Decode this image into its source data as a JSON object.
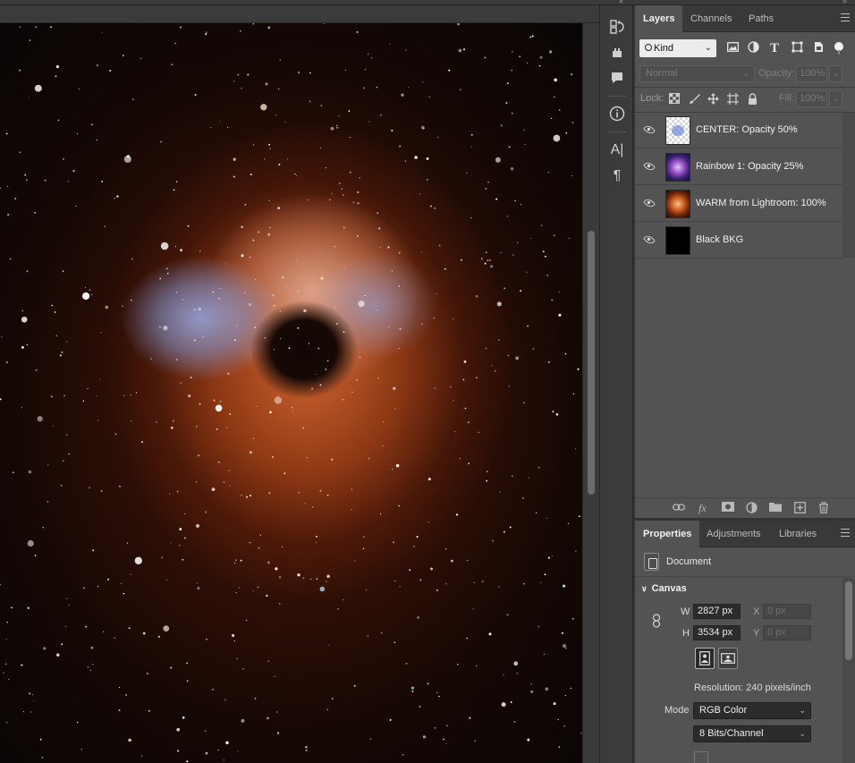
{
  "layers_panel": {
    "tabs": [
      {
        "label": "Layers",
        "active": true
      },
      {
        "label": "Channels",
        "active": false
      },
      {
        "label": "Paths",
        "active": false
      }
    ],
    "filter_kind": "Kind",
    "filter_icons": [
      "image-filter-icon",
      "adjustment-filter-icon",
      "type-filter-icon",
      "shape-filter-icon",
      "smart-object-filter-icon",
      "filter-toggle-icon"
    ],
    "blend_mode": "Normal",
    "opacity_label": "Opacity:",
    "opacity_value": "100%",
    "lock_label": "Lock:",
    "fill_label": "Fill:",
    "fill_value": "100%",
    "layers": [
      {
        "name": "CENTER: Opacity 50%",
        "visible": true,
        "thumb": "transparent-blue"
      },
      {
        "name": "Rainbow 1: Opacity 25%",
        "visible": true,
        "thumb": "purple-nebula"
      },
      {
        "name": "WARM from Lightroom: 100%",
        "visible": true,
        "thumb": "orange-nebula"
      },
      {
        "name": "Black BKG",
        "visible": true,
        "thumb": "black"
      }
    ],
    "footer_icons": [
      "link-icon",
      "fx-icon",
      "mask-icon",
      "adjustment-icon",
      "folder-icon",
      "new-layer-icon",
      "trash-icon"
    ]
  },
  "properties_panel": {
    "tabs": [
      {
        "label": "Properties",
        "active": true
      },
      {
        "label": "Adjustments",
        "active": false
      },
      {
        "label": "Libraries",
        "active": false
      }
    ],
    "document_label": "Document",
    "canvas_section": "Canvas",
    "w_label": "W",
    "w_value": "2827 px",
    "h_label": "H",
    "h_value": "3534 px",
    "x_label": "X",
    "x_value": "0 px",
    "y_label": "Y",
    "y_value": "0 px",
    "resolution": "Resolution: 240 pixels/inch",
    "mode_label": "Mode",
    "mode_value": "RGB Color",
    "bits_value": "8 Bits/Channel"
  },
  "tool_column_icons": [
    "history-icon",
    "actions-icon",
    "comments-icon",
    "info-icon",
    "character-icon",
    "paragraph-icon"
  ],
  "colors": {
    "panel_bg": "#535353",
    "tab_bg": "#393939",
    "app_bg": "#323232",
    "nebula_orange": "#c8602a",
    "nebula_blue": "#96aae6"
  }
}
